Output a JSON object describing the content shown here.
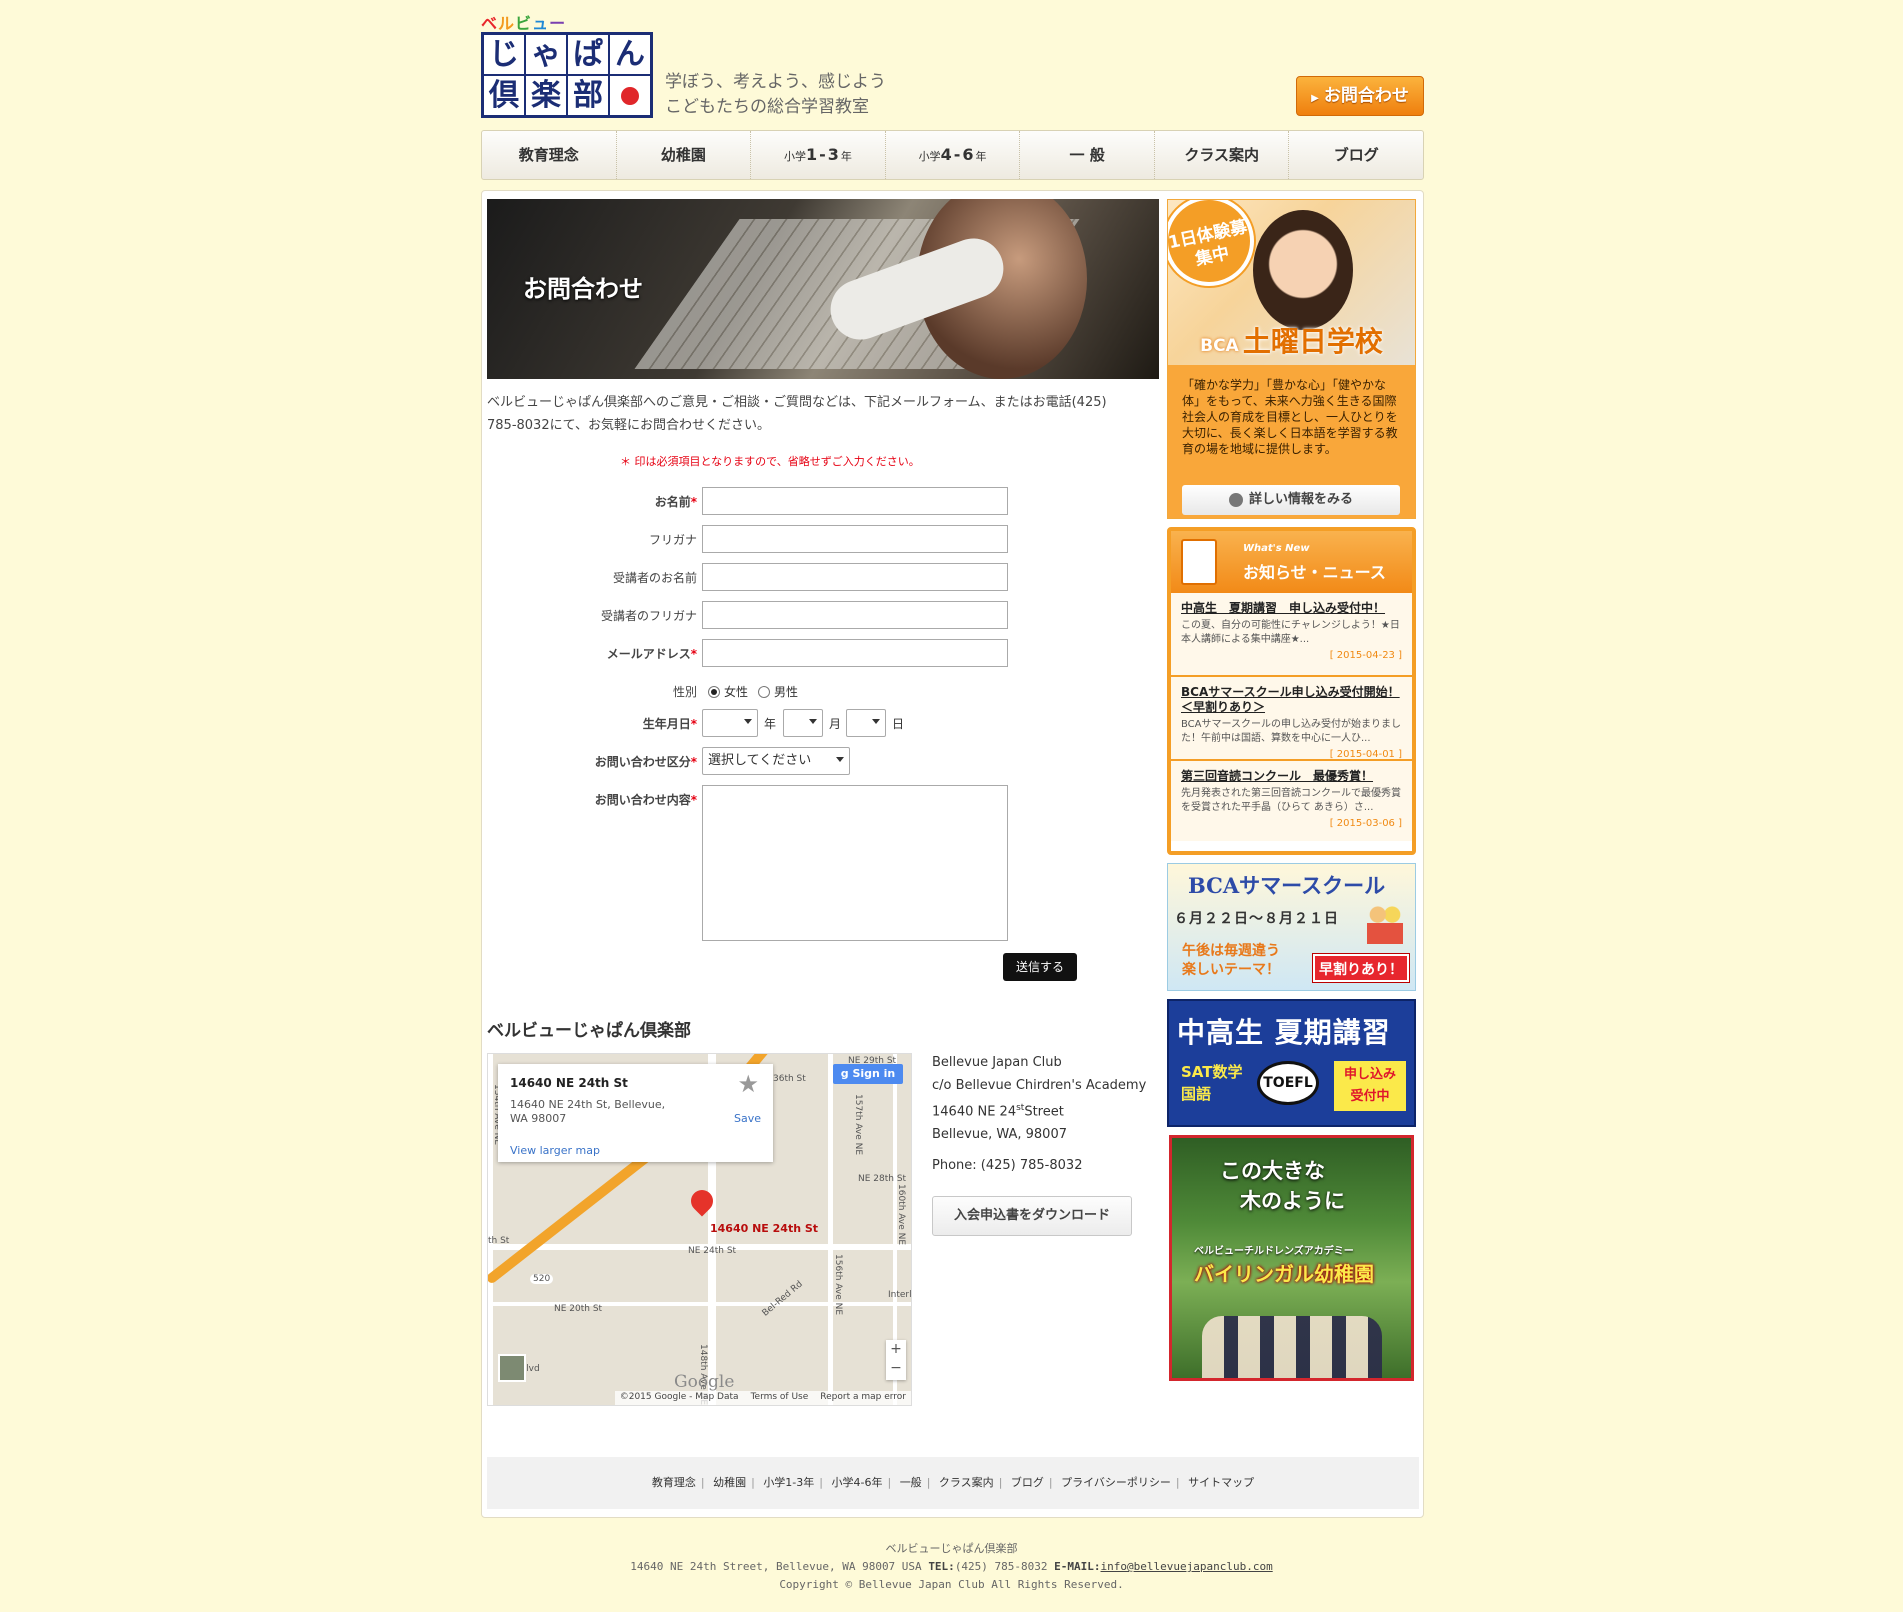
{
  "header": {
    "logo_kana": "ベルビュー",
    "logo_chars": [
      "じ",
      "ゃ",
      "ぱ",
      "ん",
      "倶",
      "楽",
      "部"
    ],
    "tagline_1": "学ぼう、考えよう、感じよう",
    "tagline_2": "こどもたちの総合学習教室",
    "contact_button": "お問合わせ"
  },
  "nav": {
    "items": [
      {
        "label": "教育理念"
      },
      {
        "label": "幼稚園"
      },
      {
        "prefix": "小学",
        "grade": "1-3",
        "suffix": "年"
      },
      {
        "prefix": "小学",
        "grade": "4-6",
        "suffix": "年"
      },
      {
        "label": "一 般"
      },
      {
        "label": "クラス案内"
      },
      {
        "label": "ブログ"
      }
    ]
  },
  "hero": {
    "title": "お問合わせ"
  },
  "intro": "ベルビューじゃぱん倶楽部へのご意見・ご相談・ご質問などは、下記メールフォーム、またはお電話(425) 785-8032にて、お気軽にお問合わせください。",
  "form": {
    "required_note": "＊ 印は必須項目となりますので、省略せずご入力ください。",
    "name_label": "お名前",
    "furigana_label": "フリガナ",
    "student_name_label": "受講者のお名前",
    "student_furigana_label": "受講者のフリガナ",
    "email_label": "メールアドレス",
    "gender_label": "性別",
    "gender_female": "女性",
    "gender_male": "男性",
    "birth_label": "生年月日",
    "year_unit": "年",
    "month_unit": "月",
    "day_unit": "日",
    "category_label": "お問い合わせ区分",
    "category_value": "選択してください",
    "content_label": "お問い合わせ内容",
    "required_mark": "*",
    "submit_label": "送信する"
  },
  "club": {
    "title": "ベルビューじゃぱん倶楽部",
    "address_lines": [
      "Bellevue Japan Club",
      "c/o Bellevue Chirdren's Academy",
      "14640 NE 24",
      "Bellevue, WA, 98007"
    ],
    "street_sup": "st",
    "street_rest": "Street",
    "phone": "Phone: (425) 785-8032",
    "download_button": "入会申込書をダウンロード"
  },
  "map": {
    "card_title": "14640 NE 24th St",
    "card_address": "14640 NE 24th St, Bellevue, WA 98007",
    "card_link": "View larger map",
    "save": "Save",
    "sign_in": "Sign in",
    "pin_label": "14640 NE 24th St",
    "labels": [
      "NE 24th St",
      "NE 20th St",
      "148th Ave NE",
      "156th Ave NE",
      "160th Ave NE",
      "157th Ave NE",
      "134th Ave NE",
      "Bel-Red Rd",
      "NE 28th St",
      "36th St",
      "520",
      "Interl",
      "th St",
      "Blvd",
      "NE 29th St"
    ],
    "google": "Google",
    "attribution": "©2015 Google - Map Data",
    "terms": "Terms of Use",
    "report": "Report a map error"
  },
  "footer_links": [
    "教育理念",
    "幼稚園",
    "小学1-3年",
    "小学4-6年",
    "一般",
    "クラス案内",
    "ブログ",
    "プライバシーポリシー",
    "サイトマップ"
  ],
  "sidebar": {
    "sat": {
      "badge": "1日体験募集中",
      "bca": "BCA",
      "title": "土曜日学校",
      "body": "「確かな学力」「豊かな心」「健やかな体」をもって、未来へ力強く生きる国際社会人の育成を目標とし、一人ひとりを大切に、長く楽しく日本語を学習する教育の場を地域に提供します。",
      "more": "詳しい情報をみる"
    },
    "news": {
      "en": "What's New",
      "jp": "お知らせ・ニュース",
      "items": [
        {
          "title": "中高生　夏期講習　申し込み受付中！",
          "desc": "この夏、自分の可能性にチャレンジしよう！★日本人講師による集中講座★...",
          "date": "[ 2015-04-23 ]"
        },
        {
          "title": "BCAサマースクール申し込み受付開始！＜早割りあり＞",
          "desc": "BCAサマースクールの申し込み受付が始まりました！午前中は国語、算数を中心に一人ひ...",
          "date": "[ 2015-04-01 ]"
        },
        {
          "title": "第三回音読コンクール　最優秀賞！",
          "desc": "先月発表された第三回音読コンクールで最優秀賞を受賞された平手晶（ひらて あきら）さ...",
          "date": "[ 2015-03-06 ]"
        }
      ]
    },
    "summer": {
      "title": "BCAサマースクール",
      "dates": "６月２２日〜８月２１日",
      "line1": "午後は毎週違う",
      "line2": "楽しいテーマ！",
      "early": "早割りあり！"
    },
    "hs": {
      "title": "中高生 夏期講習",
      "subjects1": "SAT数学",
      "subjects2": "国語",
      "toefl": "TOEFL",
      "apply1": "申し込み",
      "apply2": "受付中"
    },
    "kinder": {
      "line1": "この大きな",
      "line2": "木のように",
      "school": "ベルビューチルドレンズアカデミー",
      "title": "バイリンガル幼稚園"
    }
  },
  "site_footer": {
    "name": "ベルビューじゃぱん倶楽部",
    "address": "14640 NE 24th Street, Bellevue, WA 98007 USA",
    "tel_label": "TEL:",
    "tel": "(425) 785-8032",
    "email_label": "E-MAIL:",
    "email": "info@bellevuejapanclub.com",
    "copyright": "Copyright © Bellevue Japan Club All Rights Reserved."
  },
  "colors": {
    "page_bg": "#fefad8",
    "accent_orange": "#f49e26",
    "required_red": "#e60012",
    "logo_navy": "#1b2d75"
  }
}
